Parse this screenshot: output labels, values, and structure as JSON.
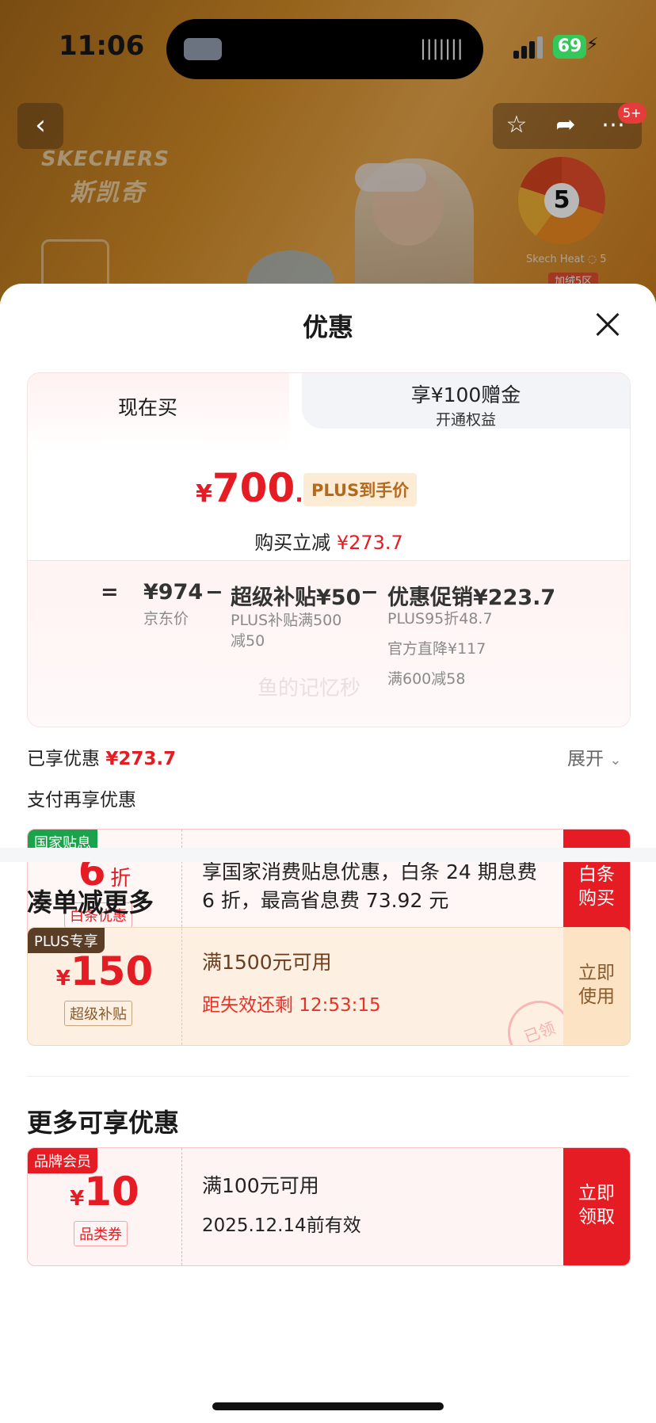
{
  "status_bar": {
    "time": "11:06",
    "battery": "69"
  },
  "product_banner": {
    "brand_en": "SKECHERS",
    "brand_cn": "斯凯奇",
    "dial_number": "5",
    "heat_label": "Skech Heat ◌ 5",
    "heat_tag": "加绒5区"
  },
  "nav": {
    "badge": "5+"
  },
  "sheet": {
    "title": "优惠",
    "tabs": {
      "active": "现在买",
      "inactive_line1": "享¥100赠金",
      "inactive_line2": "开通权益"
    },
    "price": {
      "symbol": "¥",
      "integer": "700",
      "decimal": ".3",
      "tag": "PLUS到手价",
      "reduce_label": "购买立减",
      "reduce_amount": "¥273.7"
    },
    "breakdown": {
      "eq": "=",
      "jd_price": "¥974",
      "minus1": "−",
      "subsidy": "超级补贴¥50",
      "minus2": "−",
      "promo": "优惠促销¥223.7",
      "jd_label": "京东价",
      "subsidy_detail": "PLUS补贴满500\n减50",
      "promo_detail_1": "PLUS95折48.7",
      "promo_detail_2": "官方直降¥117",
      "promo_detail_3": "满600减58",
      "watermark": "鱼的记忆秒"
    },
    "enjoyed_label": "已享优惠",
    "enjoyed_amount": "¥273.7",
    "expand_label": "展开",
    "pay_more_label": "支付再享优惠",
    "coupon_baitiao": {
      "tag": "国家贴息",
      "amount": "6",
      "unit": "折",
      "sub": "白条优惠",
      "text": "享国家消费贴息优惠，白条 24 期息费 6 折，最高省息费 73.92 元",
      "action": "白条购买"
    },
    "section_more": "凑单减更多",
    "coupon_plus": {
      "tag": "PLUS专享",
      "symbol": "¥",
      "amount": "150",
      "sub": "超级补贴",
      "text": "满1500元可用",
      "countdown": "距失效还剩 12:53:15",
      "stamp": "已领",
      "action": "立即使用"
    },
    "section_extra": "更多可享优惠",
    "coupon_brand": {
      "tag": "品牌会员",
      "symbol": "¥",
      "amount": "10",
      "sub": "品类券",
      "text": "满100元可用",
      "expiry": "2025.12.14前有效",
      "action": "立即领取"
    }
  },
  "colors": {
    "accent_red": "#e51c23",
    "gold": "#b36a1d",
    "green_tag": "#1aa34a"
  }
}
